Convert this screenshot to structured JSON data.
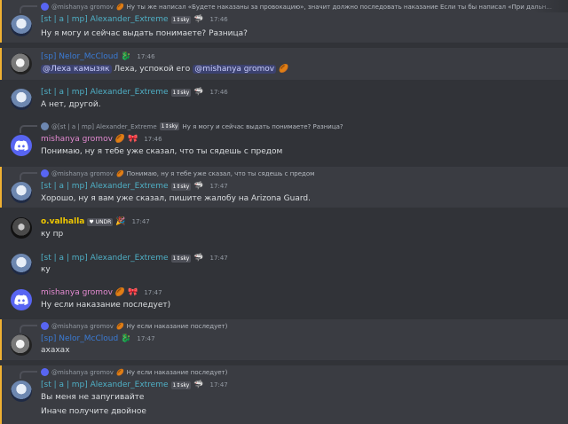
{
  "top": {
    "reply_name": "@mishanya gromov",
    "reply_text": "Ну ты же написал «Будете наказаны за провокацию», значит должно последовать наказание Если ты бы написал «При дальн...",
    "author": "[st | a | mp] Alexander_Extreme",
    "tag": "1↕sky",
    "time": "17:46",
    "text": "Ну я могу и сейчас выдать понимаете? Разница?"
  },
  "m2": {
    "author": "[sp] Nelor_McCloud",
    "time": "17:46",
    "mention1": "@Леха камызяк",
    "text_mid": " Леха, успокой его ",
    "mention2": "@mishanya gromov"
  },
  "m3": {
    "author": "[st | a | mp] Alexander_Extreme",
    "tag": "1↕sky",
    "time": "17:46",
    "text": "А нет, другой."
  },
  "m4": {
    "reply_name": "@[st | a | mp] Alexander_Extreme",
    "reply_tag": "1↕sky",
    "reply_text": "Ну я могу и сейчас выдать понимаете? Разница?",
    "author": "mishanya gromov",
    "time": "17:46",
    "text": "Понимаю, ну я тебе уже сказал, что ты сядешь с предом"
  },
  "m5": {
    "reply_name": "@mishanya gromov",
    "reply_text": "Понимаю, ну я тебе уже сказал, что ты сядешь с предом",
    "author": "[st | a | mp] Alexander_Extreme",
    "tag": "1↕sky",
    "time": "17:47",
    "text": "Хорошо, ну я вам уже сказал, пишите жалобу на Arizona Guard."
  },
  "m6": {
    "author": "o.valhalla",
    "badge": "UNDR",
    "time": "17:47",
    "text": "ку пр"
  },
  "m7": {
    "author": "[st | a | mp] Alexander_Extreme",
    "tag": "1↕sky",
    "time": "17:47",
    "text": "ку"
  },
  "m8": {
    "author": "mishanya gromov",
    "time": "17:47",
    "text": "Ну если наказание последует)"
  },
  "m9": {
    "reply_name": "@mishanya gromov",
    "reply_text": "Ну если наказание последует)",
    "author": "[sp] Nelor_McCloud",
    "time": "17:47",
    "text": "ахахах"
  },
  "m10": {
    "reply_name": "@mishanya gromov",
    "reply_text": "Ну если наказание последует)",
    "author": "[st | a | mp] Alexander_Extreme",
    "tag": "1↕sky",
    "time": "17:47",
    "text1": "Вы меня не запугивайте",
    "text2": "Иначе получите двойное"
  },
  "colors": {
    "background": "#313338",
    "highlight": "#3a3c42",
    "alexander": "#4fb0c6",
    "nelor": "#3a7bd5",
    "mishanya": "#e38ad0",
    "ovalhalla": "#f0c800"
  }
}
